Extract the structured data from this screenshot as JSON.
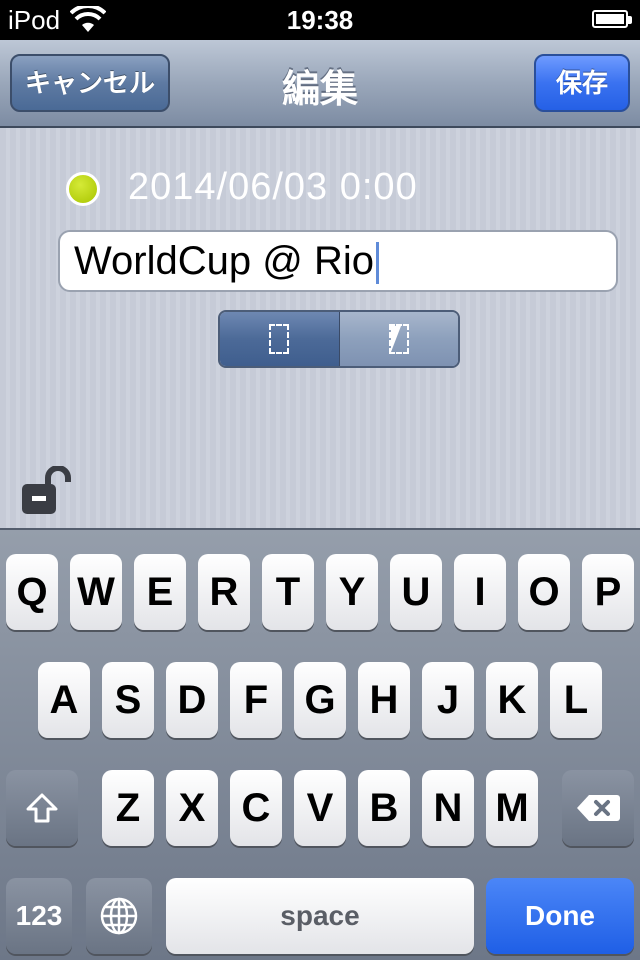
{
  "status_bar": {
    "carrier": "iPod",
    "time": "19:38"
  },
  "nav": {
    "cancel_label": "キャンセル",
    "title": "編集",
    "save_label": "保存"
  },
  "event": {
    "datetime": "2014/06/03 0:00",
    "title_value": "WorldCup @ Rio",
    "dot_color": "#a8c400"
  },
  "segment": {
    "options": [
      "hollow",
      "half"
    ],
    "selected": 0
  },
  "keyboard": {
    "row1": [
      "Q",
      "W",
      "E",
      "R",
      "T",
      "Y",
      "U",
      "I",
      "O",
      "P"
    ],
    "row2": [
      "A",
      "S",
      "D",
      "F",
      "G",
      "H",
      "J",
      "K",
      "L"
    ],
    "row3": [
      "Z",
      "X",
      "C",
      "V",
      "B",
      "N",
      "M"
    ],
    "numbers_label": "123",
    "space_label": "space",
    "done_label": "Done",
    "icons": {
      "shift": "shift-arrow-icon",
      "delete": "backspace-icon",
      "globe": "globe-icon"
    }
  }
}
